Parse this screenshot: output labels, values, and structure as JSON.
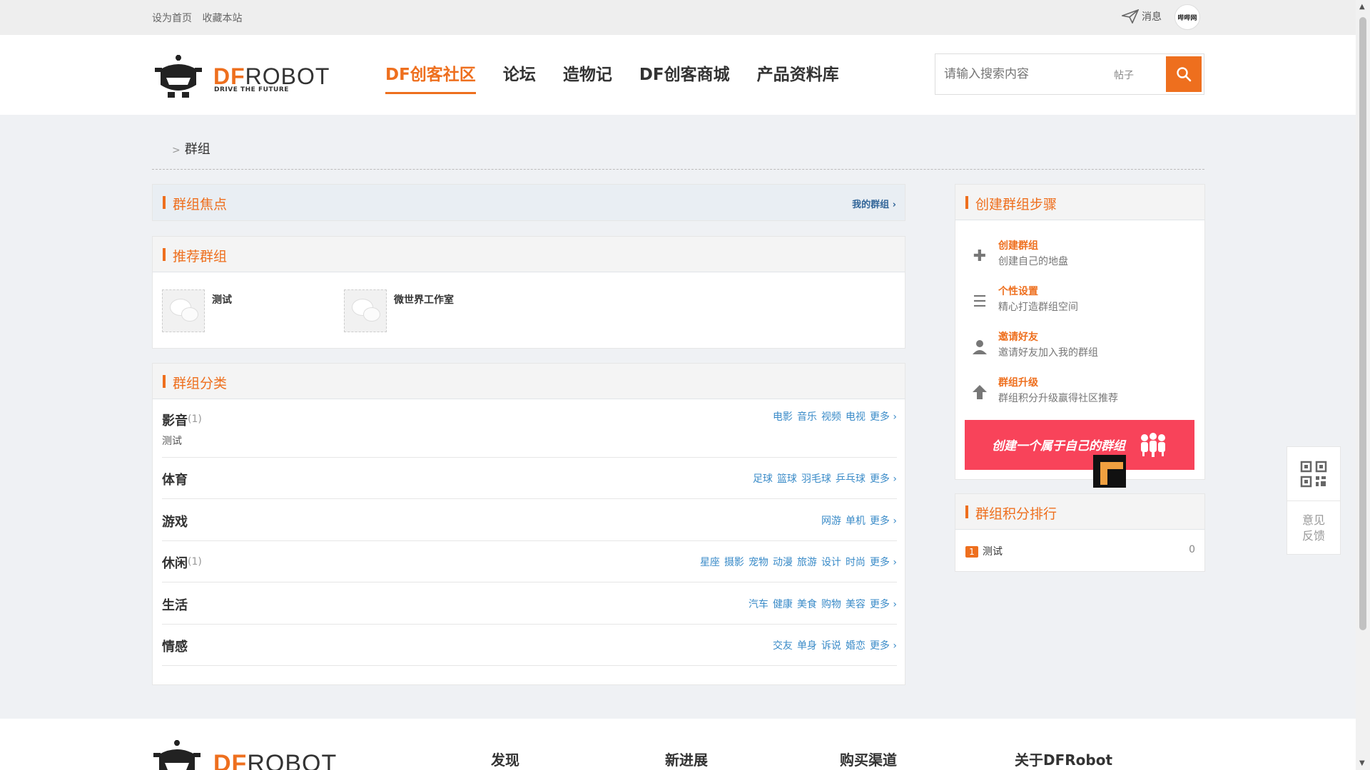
{
  "topbar": {
    "links": [
      "设为首页",
      "收藏本站"
    ],
    "message_label": "消息",
    "avatar_text": "哔哔网"
  },
  "header": {
    "logo": {
      "df": "DF",
      "robot": "ROBOT",
      "tagline": "DRIVE THE FUTURE"
    },
    "nav": [
      "DF创客社区",
      "论坛",
      "造物记",
      "DF创客商城",
      "产品资料库"
    ],
    "active_nav": "DF创客社区",
    "search": {
      "placeholder": "请输入搜索内容",
      "type": "帖子"
    }
  },
  "breadcrumb": {
    "separator": ">",
    "current": "群组"
  },
  "focus": {
    "title": "群组焦点",
    "more": "我的群组 ›"
  },
  "recommend": {
    "title": "推荐群组",
    "groups": [
      {
        "name": "测试"
      },
      {
        "name": "微世界工作室"
      }
    ]
  },
  "category": {
    "title": "群组分类",
    "rows": [
      {
        "name": "影音",
        "count": "(1)",
        "sub": "测试",
        "tags": [
          "电影",
          "音乐",
          "视频",
          "电视",
          "更多 ›"
        ]
      },
      {
        "name": "体育",
        "count": "",
        "sub": "",
        "tags": [
          "足球",
          "篮球",
          "羽毛球",
          "乒乓球",
          "更多 ›"
        ]
      },
      {
        "name": "游戏",
        "count": "",
        "sub": "",
        "tags": [
          "网游",
          "单机",
          "更多 ›"
        ]
      },
      {
        "name": "休闲",
        "count": "(1)",
        "sub": "",
        "tags": [
          "星座",
          "摄影",
          "宠物",
          "动漫",
          "旅游",
          "设计",
          "时尚",
          "更多 ›"
        ]
      },
      {
        "name": "生活",
        "count": "",
        "sub": "",
        "tags": [
          "汽车",
          "健康",
          "美食",
          "购物",
          "美容",
          "更多 ›"
        ]
      },
      {
        "name": "情感",
        "count": "",
        "sub": "",
        "tags": [
          "交友",
          "单身",
          "诉说",
          "婚恋",
          "更多 ›"
        ]
      }
    ]
  },
  "steps": {
    "title": "创建群组步骤",
    "items": [
      {
        "icon": "plus-icon",
        "title": "创建群组",
        "desc": "创建自己的地盘"
      },
      {
        "icon": "list-icon",
        "title": "个性设置",
        "desc": "精心打造群组空间"
      },
      {
        "icon": "user-icon",
        "title": "邀请好友",
        "desc": "邀请好友加入我的群组"
      },
      {
        "icon": "arrow-up-icon",
        "title": "群组升级",
        "desc": "群组积分升级赢得社区推荐"
      }
    ],
    "banner_text": "创建一个属于自己的群组"
  },
  "rank": {
    "title": "群组积分排行",
    "items": [
      {
        "rank": "1",
        "name": "测试",
        "score": "0"
      }
    ]
  },
  "float": {
    "feedback": "意见\n反馈"
  },
  "footer": {
    "columns": [
      "发现",
      "新进展",
      "购买渠道",
      "关于DFRobot"
    ]
  },
  "colors": {
    "accent": "#ee6f1e",
    "link": "#3a8bc8",
    "banner": "#f8435a"
  }
}
